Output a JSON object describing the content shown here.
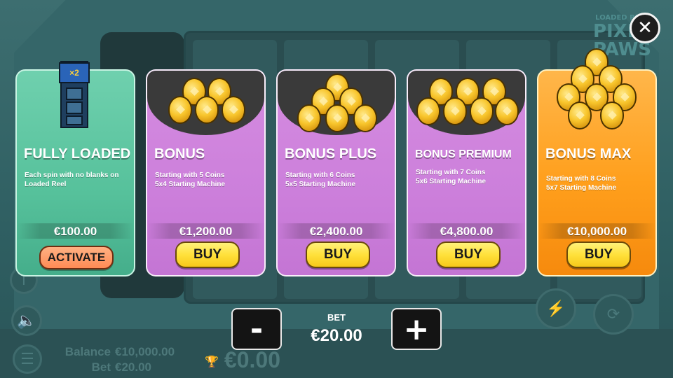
{
  "game": {
    "logo_top": "LOADED REEL",
    "logo_main": "PIXEL PAWS"
  },
  "background": {
    "balance_label": "Balance",
    "balance_value": "€10,000.00",
    "bet_label": "Bet",
    "bet_value": "€20.00",
    "win_value": "€0.00"
  },
  "close": {
    "label": "✕"
  },
  "cards": [
    {
      "title": "FULLY LOADED",
      "desc": [
        "Each spin with no blanks on",
        "Loaded Reel"
      ],
      "price": "€100.00",
      "button": "ACTIVATE",
      "icon": "loaded-reel-icon",
      "icon_badge": "×2",
      "color": "#56c19b"
    },
    {
      "title": "BONUS",
      "desc": [
        "Starting with 5 Coins",
        "5x4 Starting Machine"
      ],
      "price": "€1,200.00",
      "button": "BUY",
      "color": "#cc7fdb"
    },
    {
      "title": "BONUS PLUS",
      "desc": [
        "Starting with 6 Coins",
        "5x5 Starting Machine"
      ],
      "price": "€2,400.00",
      "button": "BUY",
      "color": "#cc7fdb"
    },
    {
      "title": "BONUS PREMIUM",
      "desc": [
        "Starting with 7 Coins",
        "5x6 Starting Machine"
      ],
      "price": "€4,800.00",
      "button": "BUY",
      "color": "#cc7fdb"
    },
    {
      "title": "BONUS MAX",
      "desc": [
        "Starting with 8 Coins",
        "5x7 Starting Machine"
      ],
      "price": "€10,000.00",
      "button": "BUY",
      "color": "#ff9f1c"
    }
  ],
  "bet": {
    "label": "BET",
    "value": "€20.00",
    "minus": "-",
    "plus": "+"
  },
  "icons": {
    "sound": "speaker-icon",
    "menu": "menu-icon",
    "turbo": "lightning-icon",
    "autoplay": "refresh-icon",
    "win": "trophy-icon"
  }
}
